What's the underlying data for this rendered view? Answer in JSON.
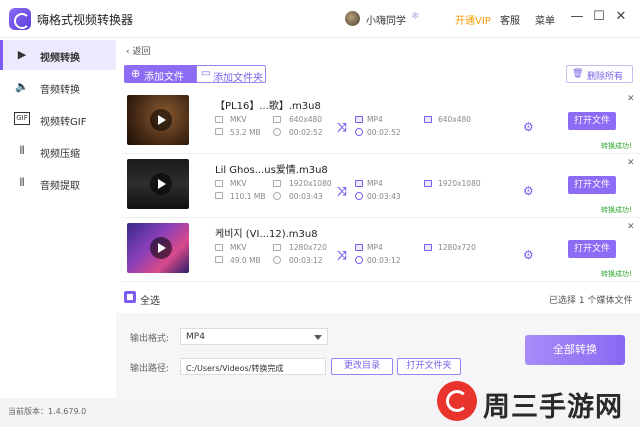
{
  "app": {
    "title": "嗨格式视频转换器"
  },
  "header": {
    "username": "小嗨同学",
    "vip_label": "开通VIP",
    "service_label": "客服",
    "menu_label": "菜单",
    "minimize": "—",
    "maximize": "☐",
    "close": "✕"
  },
  "sidebar": {
    "items": [
      {
        "label": "视频转换",
        "icon": "video-convert-icon",
        "active": true
      },
      {
        "label": "音频转换",
        "icon": "speaker-icon",
        "active": false
      },
      {
        "label": "视频转GIF",
        "icon": "gif-icon",
        "active": false
      },
      {
        "label": "视频压缩",
        "icon": "compress-icon",
        "active": false
      },
      {
        "label": "音频提取",
        "icon": "waveform-icon",
        "active": false
      }
    ]
  },
  "main": {
    "back_label": "返回",
    "add_file_label": "添加文件",
    "add_folder_label": "添加文件夹",
    "delete_all_label": "删除所有",
    "open_folder_label": "打开文件",
    "success_label": "转换成功!",
    "files": [
      {
        "name": "【PL16】...歌】.m3u8",
        "in_format": "MKV",
        "in_resolution": "640x480",
        "size": "53.2 MB",
        "in_duration": "00:02:52",
        "out_format": "MP4",
        "out_resolution": "640x480",
        "out_duration": "00:02:52"
      },
      {
        "name": "Lil Ghos...us爱情.m3u8",
        "in_format": "MKV",
        "in_resolution": "1920x1080",
        "size": "110.1 MB",
        "in_duration": "00:03:43",
        "out_format": "MP4",
        "out_resolution": "1920x1080",
        "out_duration": "00:03:43"
      },
      {
        "name": "케비지 (VI...12).m3u8",
        "in_format": "MKV",
        "in_resolution": "1280x720",
        "size": "49.0 MB",
        "in_duration": "00:03:12",
        "out_format": "MP4",
        "out_resolution": "1280x720",
        "out_duration": "00:03:12"
      }
    ],
    "select_all_label": "全选",
    "selected_count_text": "已选择 1 个媒体文件"
  },
  "output": {
    "format_label": "输出格式:",
    "format_value": "MP4",
    "path_label": "输出路径:",
    "path_value": "C:/Users/Videos/转换完成",
    "change_dir_label": "更改目录",
    "open_folder_label": "打开文件夹",
    "convert_all_label": "全部转换"
  },
  "footer": {
    "version_text": "当前版本：1.4.679.0"
  },
  "watermark": {
    "text": "周三手游网"
  }
}
